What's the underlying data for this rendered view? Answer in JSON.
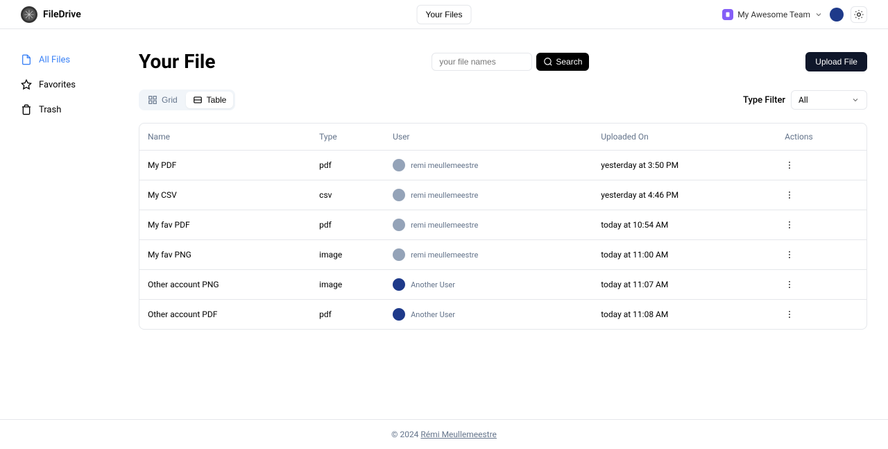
{
  "app": {
    "name": "FileDrive"
  },
  "header": {
    "center_link": "Your Files",
    "team_name": "My Awesome Team"
  },
  "sidebar": {
    "items": [
      {
        "label": "All Files",
        "icon": "file-icon",
        "active": true
      },
      {
        "label": "Favorites",
        "icon": "star-icon",
        "active": false
      },
      {
        "label": "Trash",
        "icon": "trash-icon",
        "active": false
      }
    ]
  },
  "page": {
    "title": "Your File",
    "search_placeholder": "your file names",
    "search_button": "Search",
    "upload_button": "Upload File"
  },
  "view": {
    "grid_label": "Grid",
    "table_label": "Table"
  },
  "filter": {
    "label": "Type Filter",
    "selected": "All"
  },
  "table": {
    "columns": {
      "name": "Name",
      "type": "Type",
      "user": "User",
      "uploaded": "Uploaded On",
      "actions": "Actions"
    },
    "rows": [
      {
        "name": "My PDF",
        "type": "pdf",
        "user": "remi meullemeestre",
        "uploaded": "yesterday at 3:50 PM",
        "avatar": "gray"
      },
      {
        "name": "My CSV",
        "type": "csv",
        "user": "remi meullemeestre",
        "uploaded": "yesterday at 4:46 PM",
        "avatar": "gray"
      },
      {
        "name": "My fav PDF",
        "type": "pdf",
        "user": "remi meullemeestre",
        "uploaded": "today at 10:54 AM",
        "avatar": "gray"
      },
      {
        "name": "My fav PNG",
        "type": "image",
        "user": "remi meullemeestre",
        "uploaded": "today at 11:00 AM",
        "avatar": "gray"
      },
      {
        "name": "Other account PNG",
        "type": "image",
        "user": "Another User",
        "uploaded": "today at 11:07 AM",
        "avatar": "blue"
      },
      {
        "name": "Other account PDF",
        "type": "pdf",
        "user": "Another User",
        "uploaded": "today at 11:08 AM",
        "avatar": "blue"
      }
    ]
  },
  "footer": {
    "copyright": "© 2024 ",
    "author": "Rémi Meullemeestre"
  }
}
